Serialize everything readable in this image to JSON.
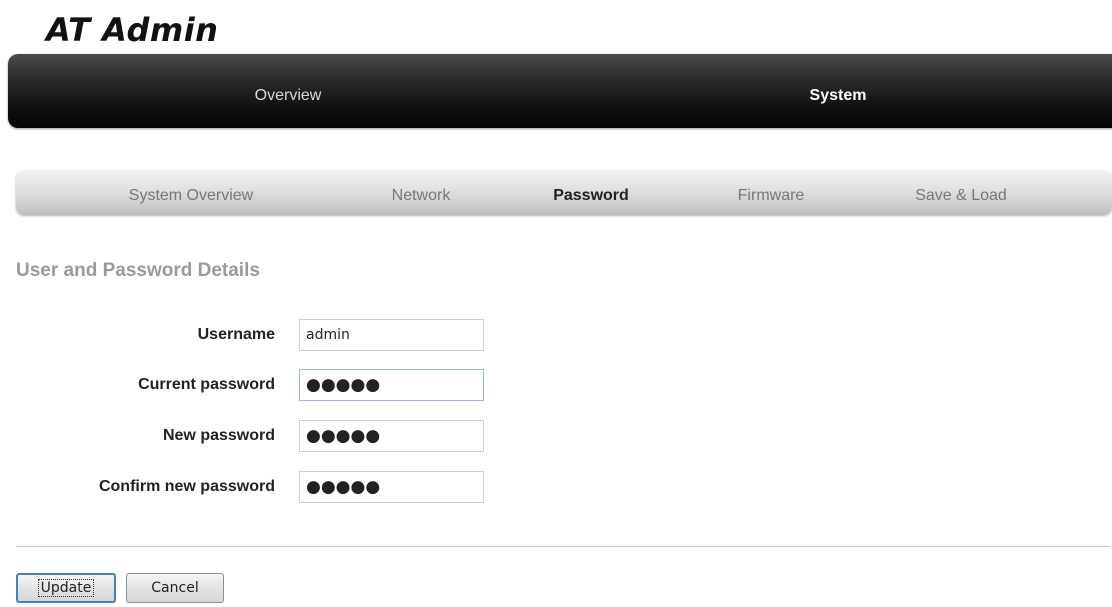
{
  "app": {
    "title": "AT Admin"
  },
  "main_nav": {
    "items": [
      {
        "label": "Overview",
        "active": false
      },
      {
        "label": "System",
        "active": true
      }
    ]
  },
  "sub_nav": {
    "items": [
      {
        "label": "System Overview",
        "active": false
      },
      {
        "label": "Network",
        "active": false
      },
      {
        "label": "Password",
        "active": true
      },
      {
        "label": "Firmware",
        "active": false
      },
      {
        "label": "Save & Load",
        "active": false
      }
    ]
  },
  "form": {
    "title": "User and Password Details",
    "fields": {
      "username": {
        "label": "Username",
        "value": "admin"
      },
      "current_password": {
        "label": "Current password",
        "value": "●●●●●"
      },
      "new_password": {
        "label": "New password",
        "value": "●●●●●"
      },
      "confirm_password": {
        "label": "Confirm new password",
        "value": "●●●●●"
      }
    }
  },
  "buttons": {
    "update": "Update",
    "cancel": "Cancel"
  },
  "colors": {
    "main_nav_bg": "#111111",
    "sub_nav_bg": "#d8d8d8",
    "section_title": "#9a9a9a",
    "focus_border": "#9ab7d6"
  }
}
